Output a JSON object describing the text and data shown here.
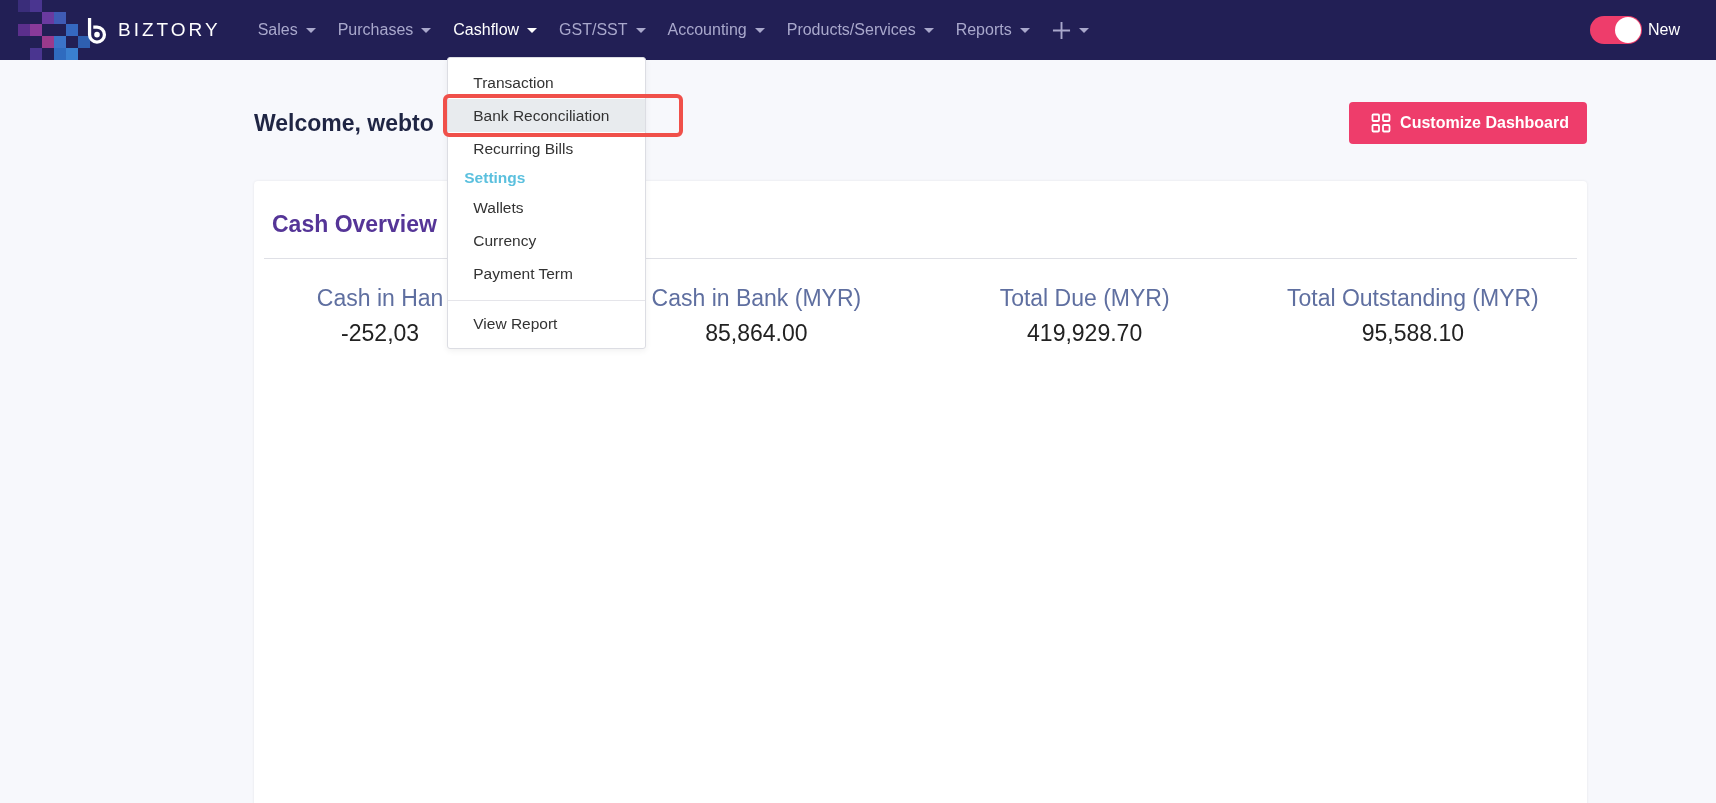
{
  "brand": {
    "name": "BIZTORY"
  },
  "nav": [
    {
      "label": "Sales",
      "selected": false
    },
    {
      "label": "Purchases",
      "selected": false
    },
    {
      "label": "Cashflow",
      "selected": true
    },
    {
      "label": "GST/SST",
      "selected": false
    },
    {
      "label": "Accounting",
      "selected": false
    },
    {
      "label": "Products/Services",
      "selected": false
    },
    {
      "label": "Reports",
      "selected": false
    }
  ],
  "new_toggle": {
    "label": "New",
    "on": true
  },
  "dropdown": {
    "items": [
      {
        "kind": "item",
        "label": "Transaction",
        "selected": false
      },
      {
        "kind": "item",
        "label": "Bank Reconciliation",
        "selected": true
      },
      {
        "kind": "item",
        "label": "Recurring Bills",
        "selected": false
      },
      {
        "kind": "header",
        "label": "Settings"
      },
      {
        "kind": "item",
        "label": "Wallets",
        "selected": false
      },
      {
        "kind": "item",
        "label": "Currency",
        "selected": false
      },
      {
        "kind": "item",
        "label": "Payment Term",
        "selected": false
      },
      {
        "kind": "divider"
      },
      {
        "kind": "item",
        "label": "View Report",
        "selected": false
      }
    ]
  },
  "welcome": "Welcome, webto",
  "customize_button": "Customize Dashboard",
  "cash_overview": {
    "title": "Cash Overview",
    "stats": [
      {
        "label": "Cash in Han",
        "value": "-252,03"
      },
      {
        "label": "Cash in Bank (MYR)",
        "value": "85,864.00"
      },
      {
        "label": "Total Due (MYR)",
        "value": "419,929.70"
      },
      {
        "label": "Total Outstanding (MYR)",
        "value": "95,588.10"
      }
    ]
  }
}
